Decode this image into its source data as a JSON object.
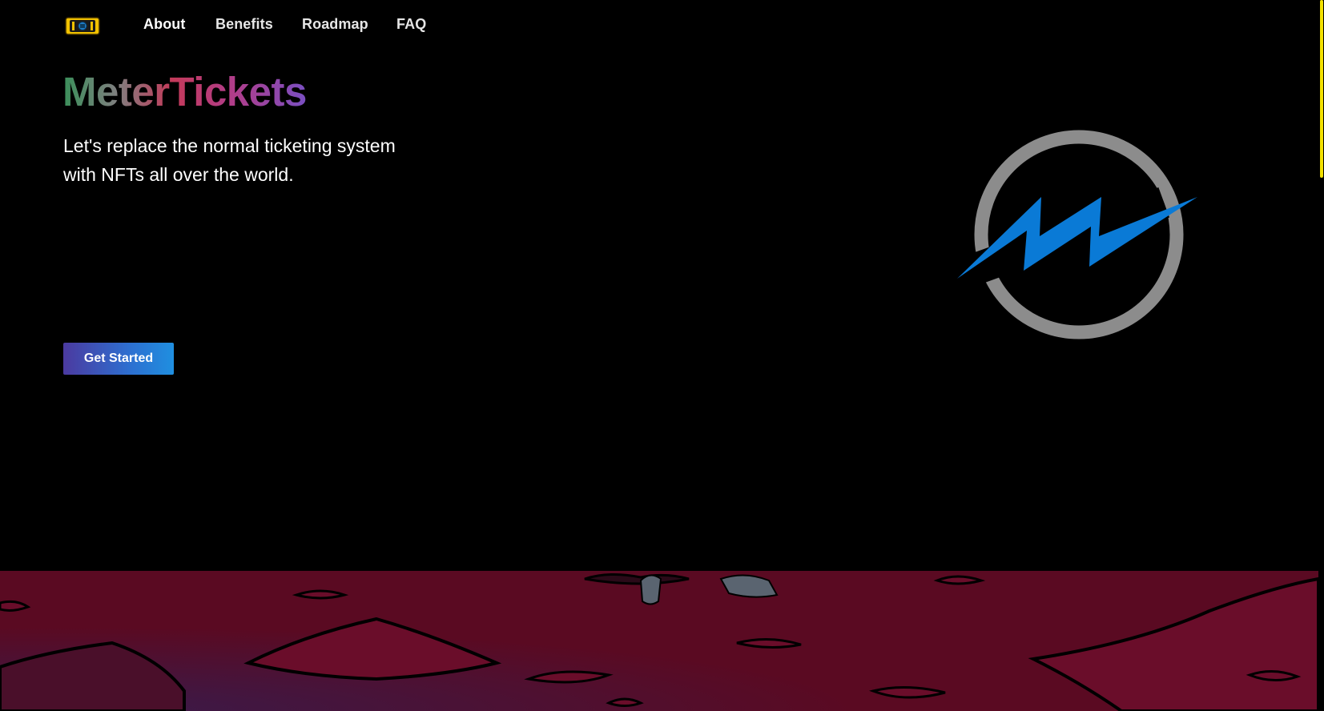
{
  "nav": {
    "logo_icon": "ticket-icon",
    "links": [
      {
        "label": "About"
      },
      {
        "label": "Benefits"
      },
      {
        "label": "Roadmap"
      },
      {
        "label": "FAQ"
      }
    ]
  },
  "hero": {
    "brand_title": "MeterTickets",
    "tagline": "Let's replace the normal ticketing system with NFTs all over the world.",
    "cta_label": "Get Started",
    "graphic_icon": "meter-lightning-logo-icon"
  },
  "colors": {
    "background": "#000000",
    "accent_blue": "#0a7ad6",
    "ring_gray": "#8c8c8c",
    "ground_red": "#5a0a22",
    "logo_yellow": "#f2c200",
    "scrollbar_yellow": "#f2e000"
  }
}
